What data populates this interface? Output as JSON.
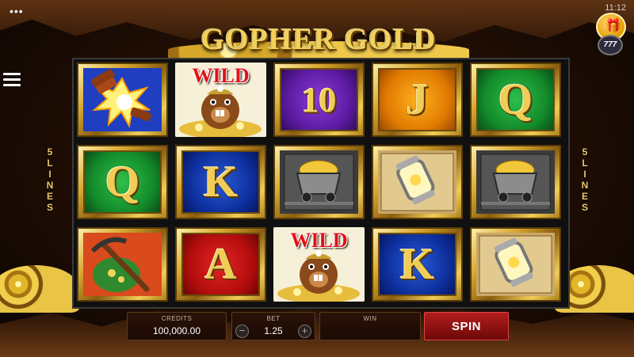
{
  "status_bar": {
    "dots": "•••",
    "time": "11:12"
  },
  "game": {
    "title": "GOPHER GOLD"
  },
  "promo": {
    "gift_icon": "gift-icon",
    "badge": "777"
  },
  "lines": {
    "count": "5",
    "word": "LINES"
  },
  "reels": [
    [
      {
        "symbol": "dynamite"
      },
      {
        "symbol": "Q",
        "color": "green"
      },
      {
        "symbol": "pickaxe"
      }
    ],
    [
      {
        "symbol": "wild-gopher",
        "label": "WILD"
      },
      {
        "symbol": "K",
        "color": "blue"
      },
      {
        "symbol": "A",
        "color": "red"
      }
    ],
    [
      {
        "symbol": "10",
        "color": "purple"
      },
      {
        "symbol": "mine-cart"
      },
      {
        "symbol": "wild-gopher",
        "label": "WILD"
      }
    ],
    [
      {
        "symbol": "J",
        "color": "orange"
      },
      {
        "symbol": "lantern"
      },
      {
        "symbol": "K",
        "color": "blue"
      }
    ],
    [
      {
        "symbol": "Q",
        "color": "green"
      },
      {
        "symbol": "mine-cart"
      },
      {
        "symbol": "lantern"
      }
    ]
  ],
  "controls": {
    "credits_label": "CREDITS",
    "credits_value": "100,000.00",
    "bet_label": "BET",
    "bet_value": "1.25",
    "bet_minus": "−",
    "bet_plus": "+",
    "win_label": "WIN",
    "win_value": "",
    "spin_label": "SPIN"
  },
  "colors": {
    "gold": "#f1cc57",
    "spin_red": "#b21e1e",
    "wild_red": "#e31212"
  }
}
